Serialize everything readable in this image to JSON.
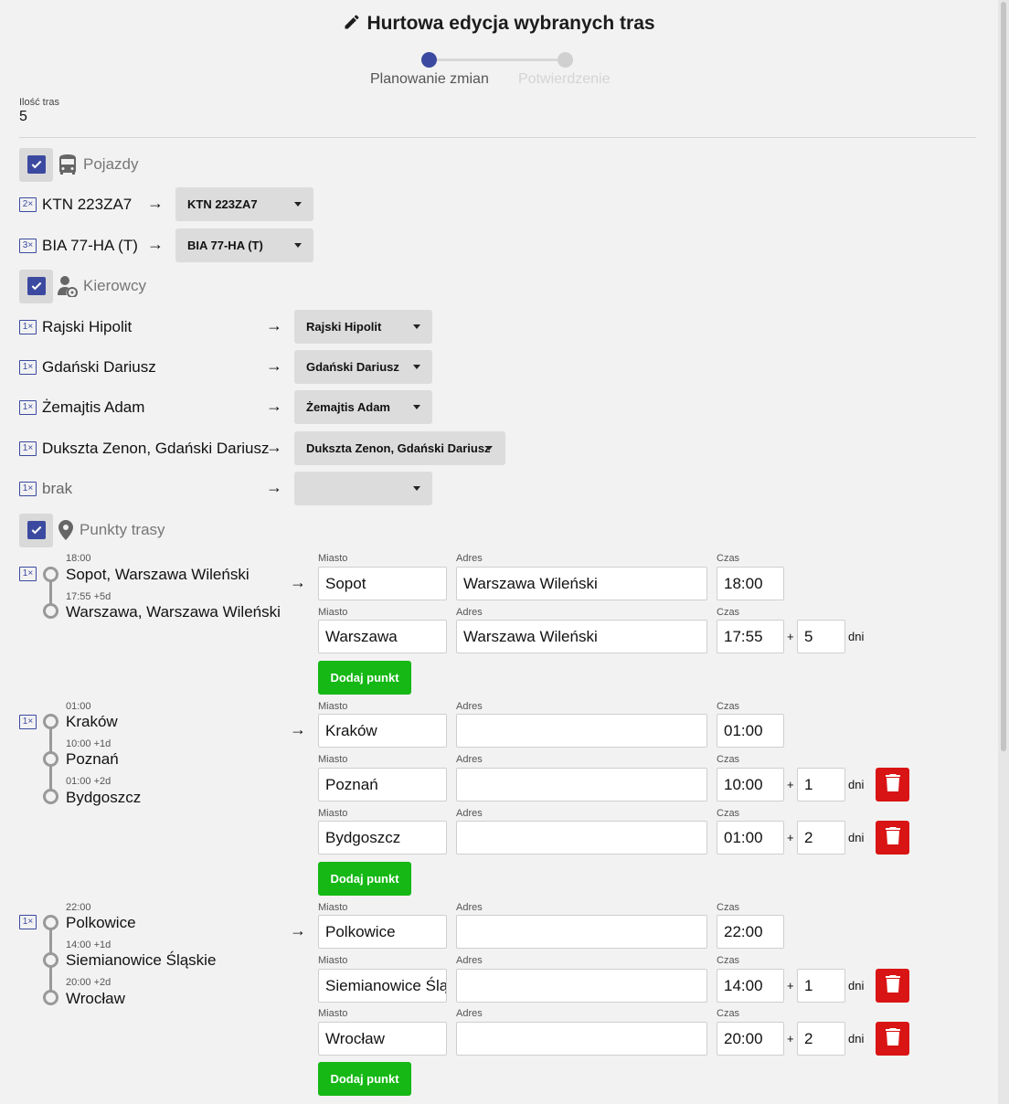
{
  "header": {
    "title": "Hurtowa edycja wybranych tras",
    "icon": "pencil-icon"
  },
  "stepper": {
    "step1": "Planowanie zmian",
    "step2": "Potwierdzenie",
    "active_step": 1
  },
  "summary": {
    "count_label": "Ilość tras",
    "count_value": "5"
  },
  "sections": {
    "vehicles": "Pojazdy",
    "drivers": "Kierowcy",
    "points": "Punkty trasy"
  },
  "vehicles": [
    {
      "badge": "2×",
      "name": "KTN 223ZA7",
      "selected": "KTN 223ZA7"
    },
    {
      "badge": "3×",
      "name": "BIA 77-HA (T)",
      "selected": "BIA 77-HA (T)"
    }
  ],
  "drivers": [
    {
      "badge": "1×",
      "name": "Rajski Hipolit",
      "selected": "Rajski Hipolit"
    },
    {
      "badge": "1×",
      "name": "Gdański Dariusz",
      "selected": "Gdański Dariusz"
    },
    {
      "badge": "1×",
      "name": "Żemajtis Adam",
      "selected": "Żemajtis Adam"
    },
    {
      "badge": "1×",
      "name": "Dukszta Zenon, Gdański Dariusz",
      "selected": "Dukszta Zenon, Gdański Dariusz"
    },
    {
      "badge": "1×",
      "name": "brak",
      "selected": ""
    }
  ],
  "labels": {
    "city": "Miasto",
    "address": "Adres",
    "time": "Czas",
    "plus": "+",
    "days": "dni",
    "add_point": "Dodaj punkt",
    "arrow": "→"
  },
  "routes": [
    {
      "badge": "1×",
      "stops": [
        {
          "time": "18:00",
          "name": "Sopot, Warszawa Wileński"
        },
        {
          "time": "17:55 +5d",
          "name": "Warszawa, Warszawa Wileński"
        }
      ],
      "points": [
        {
          "city": "Sopot",
          "address": "Warszawa Wileński",
          "time": "18:00",
          "days": ""
        },
        {
          "city": "Warszawa",
          "address": "Warszawa Wileński",
          "time": "17:55",
          "days": "5"
        }
      ]
    },
    {
      "badge": "1×",
      "stops": [
        {
          "time": "01:00",
          "name": "Kraków"
        },
        {
          "time": "10:00 +1d",
          "name": "Poznań"
        },
        {
          "time": "01:00 +2d",
          "name": "Bydgoszcz"
        }
      ],
      "points": [
        {
          "city": "Kraków",
          "address": "",
          "time": "01:00",
          "days": ""
        },
        {
          "city": "Poznań",
          "address": "",
          "time": "10:00",
          "days": "1"
        },
        {
          "city": "Bydgoszcz",
          "address": "",
          "time": "01:00",
          "days": "2"
        }
      ]
    },
    {
      "badge": "1×",
      "stops": [
        {
          "time": "22:00",
          "name": "Polkowice"
        },
        {
          "time": "14:00 +1d",
          "name": "Siemianowice Śląskie"
        },
        {
          "time": "20:00 +2d",
          "name": "Wrocław"
        }
      ],
      "points": [
        {
          "city": "Polkowice",
          "address": "",
          "time": "22:00",
          "days": ""
        },
        {
          "city": "Siemianowice Śląskie",
          "address": "",
          "time": "14:00",
          "days": "1"
        },
        {
          "city": "Wrocław",
          "address": "",
          "time": "20:00",
          "days": "2"
        }
      ]
    }
  ],
  "colors": {
    "accent": "#3b4aa0",
    "add_button": "#15b815",
    "delete_button": "#d91414"
  }
}
